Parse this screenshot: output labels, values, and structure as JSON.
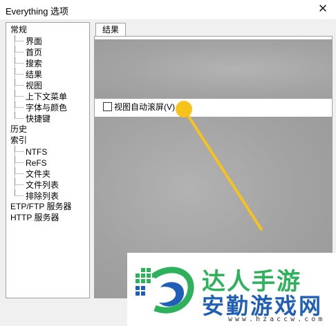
{
  "window": {
    "title": "Everything 选项",
    "close_glyph": "✕"
  },
  "tree": {
    "items": [
      {
        "label": "常规",
        "level": 0
      },
      {
        "label": "界面",
        "level": 1
      },
      {
        "label": "首页",
        "level": 1
      },
      {
        "label": "搜索",
        "level": 1
      },
      {
        "label": "结果",
        "level": 1
      },
      {
        "label": "视图",
        "level": 1
      },
      {
        "label": "上下文菜单",
        "level": 1
      },
      {
        "label": "字体与颜色",
        "level": 1
      },
      {
        "label": "快捷键",
        "level": 1
      },
      {
        "label": "历史",
        "level": 0
      },
      {
        "label": "索引",
        "level": 0
      },
      {
        "label": "NTFS",
        "level": 1
      },
      {
        "label": "ReFS",
        "level": 1
      },
      {
        "label": "文件夹",
        "level": 1
      },
      {
        "label": "文件列表",
        "level": 1
      },
      {
        "label": "排除列表",
        "level": 1
      },
      {
        "label": "ETP/FTP 服务器",
        "level": 0
      },
      {
        "label": "HTTP 服务器",
        "level": 0
      }
    ]
  },
  "tab": {
    "label": "结果"
  },
  "options": {
    "auto_scroll_label": "视图自动滚屏(V)",
    "auto_scroll_checked": false
  },
  "watermark": {
    "top_text": "达人手游",
    "main_text": "安勤游戏网",
    "url": "www.hzaccw.com"
  },
  "colors": {
    "cursor": "#f6c21c",
    "watermark_green": "#2db25b",
    "watermark_blue": "#1f5fb7"
  }
}
